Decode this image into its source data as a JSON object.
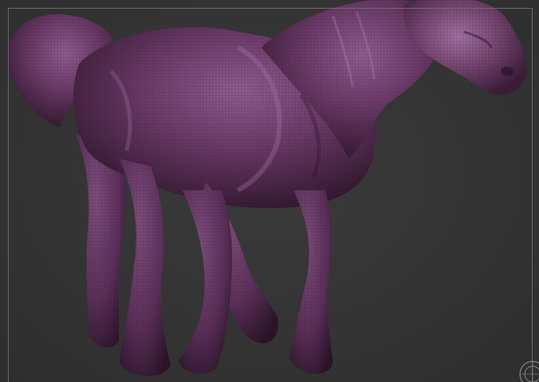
{
  "viewport": {
    "background_color": "#333333",
    "frame_color": "#6a6a6a"
  },
  "model": {
    "subject": "horse sculpt",
    "material_color": "#6b3a68",
    "highlight_color": "#9a6a9e",
    "shadow_color": "#2a1428",
    "wireframe_visible": true
  },
  "gizmo": {
    "icon": "navigation-gyro-icon"
  }
}
